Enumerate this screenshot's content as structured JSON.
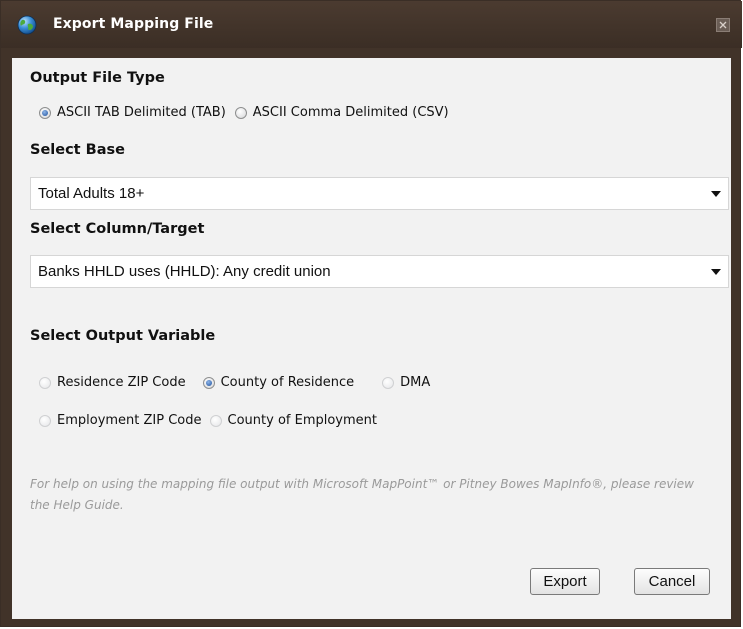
{
  "window": {
    "title": "Export Mapping File",
    "icon": "globe-icon",
    "close_icon": "close-icon"
  },
  "output_file_type": {
    "title": "Output File Type",
    "options": [
      {
        "label": "ASCII TAB Delimited (TAB)",
        "checked": true
      },
      {
        "label": "ASCII Comma Delimited (CSV)",
        "checked": false
      }
    ]
  },
  "select_base": {
    "title": "Select Base",
    "value": "Total Adults 18+"
  },
  "select_column": {
    "title": "Select Column/Target",
    "value": "Banks HHLD uses (HHLD): Any credit union"
  },
  "output_variable": {
    "title": "Select Output Variable",
    "options": [
      {
        "label": "Residence ZIP Code",
        "checked": false
      },
      {
        "label": "County of Residence",
        "checked": true
      },
      {
        "label": "DMA",
        "checked": false
      },
      {
        "label": "Employment ZIP Code",
        "checked": false
      },
      {
        "label": "County of Employment",
        "checked": false
      }
    ]
  },
  "help_text": "For help on using the mapping file output with Microsoft MapPoint™ or Pitney Bowes MapInfo®, please review the Help Guide.",
  "buttons": {
    "export": "Export",
    "cancel": "Cancel"
  },
  "colors": {
    "frame": "#413329",
    "content_bg": "#f2f2f2",
    "help_text": "#9a9a9a",
    "radio_selected": "#1c4f9c"
  }
}
